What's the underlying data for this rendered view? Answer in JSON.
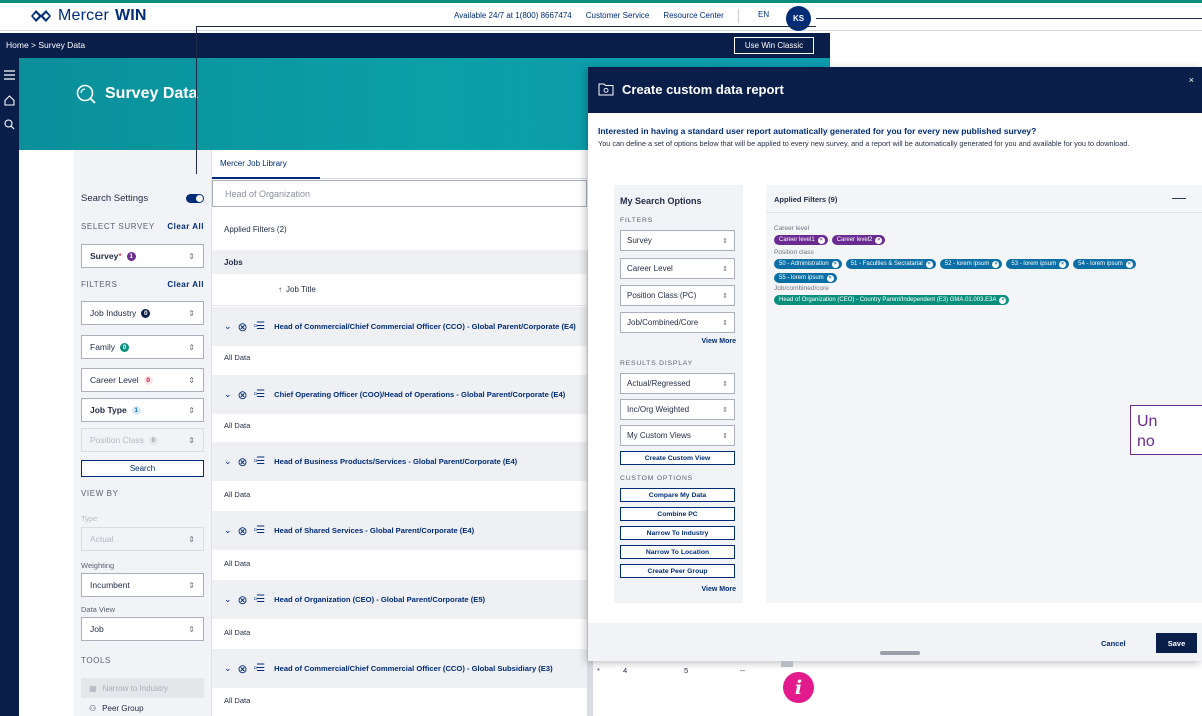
{
  "app": {
    "logo_brand": "Mercer",
    "logo_product": "WIN"
  },
  "topbar": {
    "availability": "Available 24/7 at 1(800) 8667474",
    "customer_service": "Customer Service",
    "resource_center": "Resource Center",
    "language": "EN",
    "user_initials": "KS"
  },
  "breadcrumb": {
    "text": "Home > Survey Data",
    "classic_button": "Use Win Classic"
  },
  "hero": {
    "title": "Survey Data"
  },
  "filters": {
    "search_settings": "Search Settings",
    "select_survey": "SELECT SURVEY",
    "clear_all": "Clear All",
    "survey_label": "Survey",
    "survey_required": "*",
    "survey_count": "1",
    "filters_caption": "FILTERS",
    "job_industry": "Job Industry",
    "job_industry_count": "0",
    "family": "Family",
    "family_count": "0",
    "career_level": "Career Level",
    "career_level_count": "0",
    "job_type": "Job Type",
    "job_type_count": "1",
    "position_class": "Position Class",
    "position_class_count": "0",
    "search_button": "Search",
    "view_by": "VIEW BY",
    "type_label": "Type",
    "type_value": "Actual",
    "weighting_label": "Weighting",
    "weighting_value": "Incumbent",
    "data_view_label": "Data View",
    "data_view_value": "Job",
    "tools": "TOOLS",
    "tool_narrow_industry": "Narrow to Industry",
    "tool_peer_group": "Peer Group"
  },
  "results": {
    "tab": "Mercer Job Library",
    "search_value": "Head of Organization",
    "applied_filters": "Applied Filters (2)",
    "jobs_header": "Jobs",
    "job_title_header": "Job Title",
    "sort_icon": "↑",
    "all_data": "All Data",
    "jobs": [
      "Head of Commercial/Chief Commercial Officer (CCO) - Global Parent/Corporate (E4)",
      "Chief Operating Officer (COO)/Head of Operations - Global Parent/Corporate (E4)",
      "Head of Business Products/Services - Global Parent/Corporate (E4)",
      "Head of Shared Services - Global Parent/Corporate (E4)",
      "Head of Organization (CEO) - Global Parent/Corporate (E5)",
      "Head of Commercial/Chief Commercial Officer (CCO) - Global Subsidiary (E3)"
    ],
    "pager": [
      "4",
      "5",
      "--"
    ],
    "pager_prefix": "*"
  },
  "modal": {
    "title": "Create custom data report",
    "close": "×",
    "question": "Interested in having a standard user report automatically generated for you for every new published survey?",
    "description": "You can define a set of options below that will be applied to every new survey, and a report will be automatically generated for you and available for you to download.",
    "options": {
      "title": "My Search Options",
      "filters_cap": "FILTERS",
      "survey": "Survey",
      "career_level": "Career Level",
      "position_class": "Position Class (PC)",
      "job_combined": "Job/Combined/Core",
      "view_more": "View More",
      "results_cap": "RESULTS DISPLAY",
      "actual_regressed": "Actual/Regressed",
      "inc_org": "Inc/Org Weighted",
      "custom_views": "My Custom Views",
      "create_custom_view": "Create Custom View",
      "custom_cap": "CUSTOM OPTIONS",
      "compare": "Compare My Data",
      "combine": "Combine PC",
      "narrow_industry": "Narrow To Industry",
      "narrow_location": "Narrow To Location",
      "peer_group": "Create Peer Group",
      "view_more2": "View More"
    },
    "applied": {
      "title": "Applied Filters (9)",
      "minimize": "—",
      "career_label": "Career level",
      "career_chips": [
        "Career level1",
        "Career level2"
      ],
      "position_label": "Position class",
      "position_chips": [
        "50 - Administration",
        "51 - Faculties & Secratarial",
        "52 - lorem ipsum",
        "53 - lorem ipsum",
        "54 - lorem ipsum",
        "55 - lorem ipsum"
      ],
      "job_label": "Job/combined/core",
      "job_chips": [
        "Head of Organization (CEO) - Country Parent/Independent (E3) GMA.01.003.E3A"
      ]
    },
    "cancel": "Cancel",
    "save": "Save"
  },
  "note": {
    "line1": "Un",
    "line2": "no"
  },
  "info": {
    "glyph": "i"
  },
  "colors": {
    "navy": "#0a1e4a",
    "brand_blue": "#002c77",
    "teal": "#0a8f7d",
    "purple": "#6a2c91",
    "magenta": "#e21a8b"
  }
}
